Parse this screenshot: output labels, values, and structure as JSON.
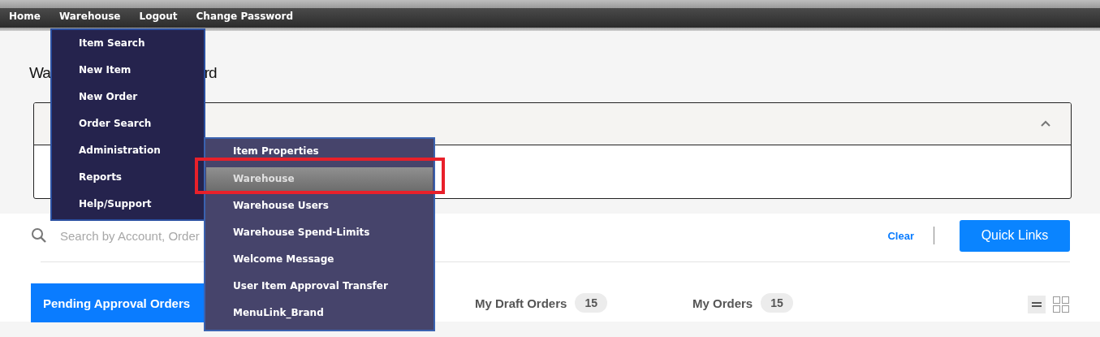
{
  "nav": {
    "items": [
      {
        "label": "Home"
      },
      {
        "label": "Warehouse"
      },
      {
        "label": "Logout"
      },
      {
        "label": "Change Password"
      }
    ]
  },
  "dropdown": {
    "items": [
      {
        "label": "Item Search"
      },
      {
        "label": "New Item"
      },
      {
        "label": "New Order"
      },
      {
        "label": "Order Search"
      },
      {
        "label": "Administration",
        "expanded": true,
        "children": [
          {
            "label": "Item Properties",
            "selected": false
          },
          {
            "label": "Warehouse",
            "selected": true
          },
          {
            "label": "Warehouse Users",
            "selected": false
          },
          {
            "label": "Warehouse Spend-Limits",
            "selected": false
          },
          {
            "label": "Welcome Message",
            "selected": false
          },
          {
            "label": "User Item Approval Transfer",
            "selected": false
          },
          {
            "label": "MenuLink_Brand",
            "selected": false
          }
        ]
      },
      {
        "label": "Reports"
      },
      {
        "label": "Help/Support"
      }
    ]
  },
  "page": {
    "title_parts": [
      "Wa",
      "rd"
    ]
  },
  "welcome_panel": {
    "expanded": true
  },
  "search": {
    "placeholder": "Search by Account, Order",
    "clear_label": "Clear",
    "quick_links_label": "Quick Links"
  },
  "tabs": [
    {
      "label": "Pending Approval Orders",
      "selected": true
    },
    {
      "label": "My Draft Orders",
      "count": "15",
      "selected": false
    },
    {
      "label": "My Orders",
      "count": "15",
      "selected": false
    }
  ],
  "view_toggles": [
    {
      "kind": "list",
      "selected": true
    },
    {
      "kind": "grid",
      "selected": false
    }
  ]
}
